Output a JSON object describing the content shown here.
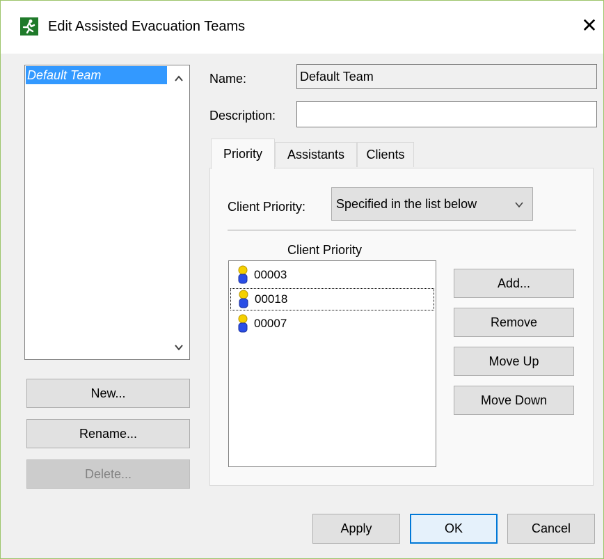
{
  "window": {
    "title": "Edit Assisted Evacuation Teams",
    "icon": "running-person-icon",
    "close_icon": "close-icon",
    "border_color": "#9cc46a"
  },
  "teams": {
    "items": [
      "Default Team"
    ],
    "selected_index": 0,
    "buttons": {
      "new_label": "New...",
      "rename_label": "Rename...",
      "delete_label": "Delete..."
    }
  },
  "form": {
    "name_label": "Name:",
    "name_value": "Default Team",
    "description_label": "Description:",
    "description_value": ""
  },
  "tabs": [
    "Priority",
    "Assistants",
    "Clients"
  ],
  "active_tab": "Priority",
  "priority": {
    "client_priority_label": "Client Priority:",
    "client_priority_value": "Specified in the list below",
    "list_header": "Client Priority",
    "clients": [
      "00003",
      "00018",
      "00007"
    ],
    "focused_index": 1,
    "buttons": {
      "add_label": "Add...",
      "remove_label": "Remove",
      "move_up_label": "Move Up",
      "move_down_label": "Move Down"
    }
  },
  "footer": {
    "apply_label": "Apply",
    "ok_label": "OK",
    "cancel_label": "Cancel"
  },
  "colors": {
    "selection": "#3399ff",
    "default_button_border": "#0078d7"
  }
}
